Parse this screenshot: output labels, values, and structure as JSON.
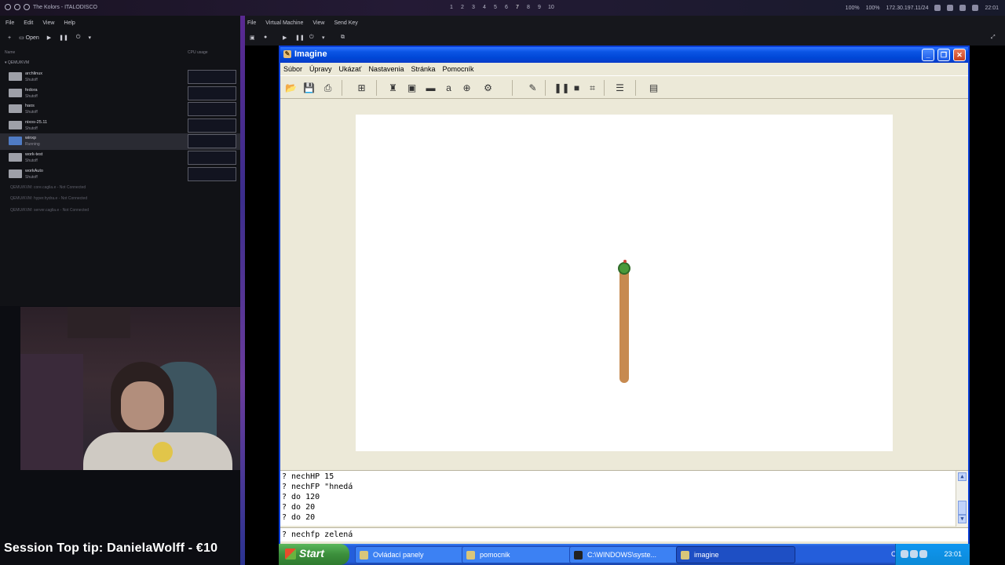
{
  "topbar": {
    "window_title": "The Kolors - ITALODISCO",
    "workspaces": [
      "1",
      "2",
      "3",
      "4",
      "5",
      "6",
      "7",
      "8",
      "9",
      "10"
    ],
    "active_workspace": "7",
    "status_left": "100%",
    "status_right": "100%",
    "ip": "172.30.197.11/24",
    "clock": "22:01"
  },
  "virt_manager": {
    "menu": [
      "File",
      "Edit",
      "View",
      "Help"
    ],
    "open_label": "Open",
    "col_name": "Name",
    "col_cpu": "CPU usage",
    "connection": "QEMU/KVM",
    "vms": [
      {
        "name": "archlinux",
        "state": "Shutoff"
      },
      {
        "name": "fedora",
        "state": "Shutoff"
      },
      {
        "name": "haos",
        "state": "Shutoff"
      },
      {
        "name": "nixos-25.11",
        "state": "Shutoff"
      },
      {
        "name": "winxp",
        "state": "Running"
      },
      {
        "name": "work-test",
        "state": "Shutoff"
      },
      {
        "name": "workAuto",
        "state": "Shutoff"
      }
    ],
    "extra_connections": [
      "QEMU/KVM: core.caglia.e - Not Connected",
      "QEMU/KVM: hyper.hydra.e - Not Connected",
      "QEMU/KVM: server.caglia.e - Not Connected"
    ]
  },
  "stream": {
    "tip_text": "Session Top tip: DanielaWolff - €10"
  },
  "viewer": {
    "menu": [
      "File",
      "Virtual Machine",
      "View",
      "Send Key"
    ]
  },
  "imagine": {
    "title": "Imagine",
    "menu": [
      "Súbor",
      "Úpravy",
      "Ukázať",
      "Nastavenia",
      "Stránka",
      "Pomocník"
    ],
    "console_lines": [
      "? nechHP 15",
      "? nechFP \"hnedá",
      "? do 120",
      "? do 20",
      "? do 20"
    ],
    "command_input": "? nechfp zelená"
  },
  "taskbar": {
    "start_label": "Start",
    "tasks": [
      "Ovládací panely",
      "pomocnik",
      "C:\\WINDOWS\\syste...",
      "imagine"
    ],
    "lang": "CS",
    "clock": "23:01"
  }
}
